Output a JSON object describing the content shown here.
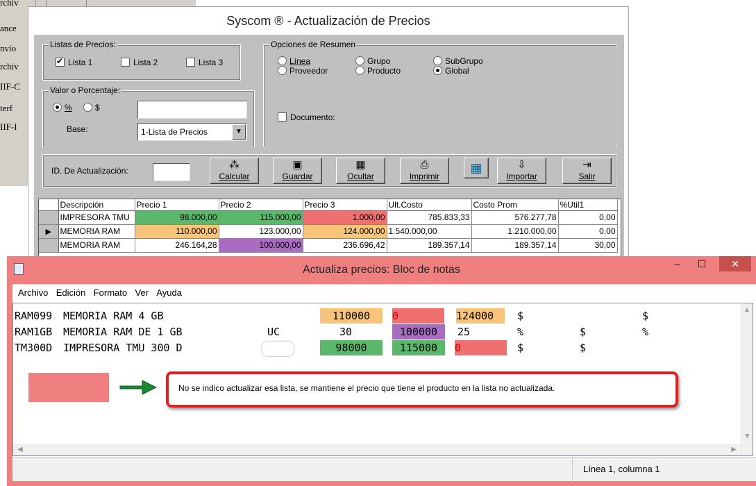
{
  "background_window": {
    "items": [
      "rchiv",
      "ance",
      "nvío",
      "rchiv",
      "IIF-C",
      "terf",
      "IIF-I"
    ]
  },
  "syscom": {
    "title": "Syscom ® - Actualización de Precios",
    "listas": {
      "legend": "Listas de Precios:",
      "items": [
        {
          "label": "Lista 1",
          "checked": true
        },
        {
          "label": "Lista 2",
          "checked": false
        },
        {
          "label": "Lista 3",
          "checked": false
        }
      ]
    },
    "opciones": {
      "legend": "Opciones de Resumen",
      "options": [
        {
          "label": "Línea",
          "selected": false
        },
        {
          "label": "Grupo",
          "selected": false
        },
        {
          "label": "SubGrupo",
          "selected": false
        },
        {
          "label": "Proveedor",
          "selected": false
        },
        {
          "label": "Producto",
          "selected": false
        },
        {
          "label": "Global",
          "selected": true
        }
      ],
      "documento_label": "Documento:"
    },
    "valor": {
      "legend": "Valor o Porcentaje:",
      "percent_label": "%",
      "dollar_label": "$",
      "value": "",
      "base_label": "Base:",
      "base_selected": "1-Lista de Precios"
    },
    "id_label": "ID. De Actualización:",
    "id_value": "",
    "toolbar": [
      {
        "label": "Calcular",
        "icon": "wand-icon"
      },
      {
        "label": "Guardar",
        "icon": "floppy-icon"
      },
      {
        "label": "Ocultar",
        "icon": "table-icon"
      },
      {
        "label": "Imprimir",
        "icon": "printer-icon"
      },
      {
        "label": "",
        "icon": "calculator-icon"
      },
      {
        "label": "Importar",
        "icon": "import-icon"
      },
      {
        "label": "Salir",
        "icon": "exit-icon"
      }
    ],
    "grid": {
      "headers": [
        "Descripción",
        "Precio 1",
        "Precio 2",
        "Precio 3",
        "Ult.Costo",
        "Costo Prom",
        "%Util1"
      ],
      "rows": [
        {
          "desc": "IMPRESORA TMU",
          "p1": "98.000,00",
          "p2": "115.000,00",
          "p3": "1.000,00",
          "ult": "785.833,33",
          "prom": "576.277,78",
          "util": "0,00",
          "c1": "#5bb86a",
          "c2": "#5bb86a",
          "c3": "#f07070",
          "current": false
        },
        {
          "desc": "MEMORIA RAM",
          "p1": "110.000,00",
          "p2": "123.000,00",
          "p3": "124.000,00",
          "ult": "1.540.000,00",
          "prom": "1.210.000,00",
          "util": "0,00",
          "c1": "#f8c47a",
          "c2": "",
          "c3": "#f8c47a",
          "current": true
        },
        {
          "desc": "MEMORIA RAM",
          "p1": "246.164,28",
          "p2": "100.000,00",
          "p3": "236.696,42",
          "ult": "189.357,14",
          "prom": "189.357,14",
          "util": "30,00",
          "c1": "",
          "c2": "#a86cc0",
          "c3": "",
          "current": false
        }
      ]
    }
  },
  "notepad": {
    "title": "Actualiza precios: Bloc de notas",
    "menu": [
      "Archivo",
      "Edición",
      "Formato",
      "Ver",
      "Ayuda"
    ],
    "lines": [
      {
        "code": "RAM099",
        "desc": "MEMORIA RAM 4 GB",
        "uc": "",
        "a": "110000",
        "b": "0",
        "c": "124000",
        "d": "$",
        "e": "",
        "f": "$",
        "ca": "#f8c47a",
        "cb": "#f07070",
        "cc": "#f8c47a"
      },
      {
        "code": "RAM1GB",
        "desc": "MEMORIA RAM DE 1 GB",
        "uc": "UC",
        "a": "30",
        "b": "100000",
        "c": "25",
        "d": "%",
        "e": "$",
        "f": "%",
        "ca": "",
        "cb": "#a86cc0",
        "cc": ""
      },
      {
        "code": "TM300D",
        "desc": "IMPRESORA TMU 300 D",
        "uc": "",
        "a": "98000",
        "b": "115000",
        "c": "0",
        "d": "$",
        "e": "$",
        "f": "",
        "ca": "#5bb86a",
        "cb": "#5bb86a",
        "cc": "#f07070"
      }
    ],
    "legend_color": "#f08080",
    "note": "No se indico actualizar esa lista, se mantiene el precio que tiene el producto en la lista no actualizada.",
    "status": "Línea 1, columna 1"
  }
}
